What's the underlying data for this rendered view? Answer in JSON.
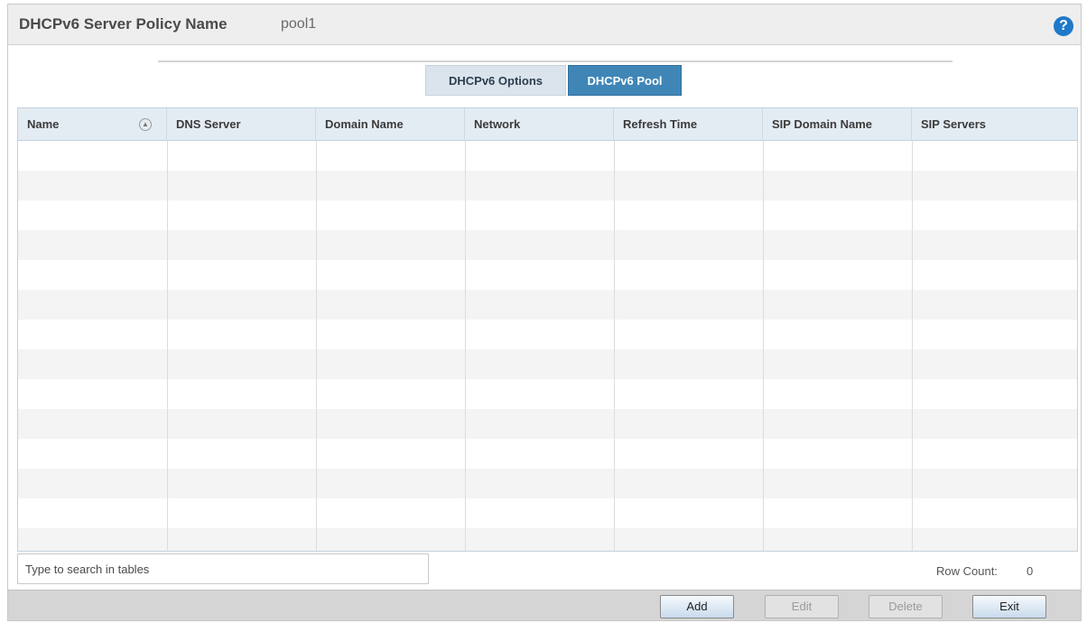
{
  "header": {
    "title_label": "DHCPv6 Server Policy Name",
    "title_value": "pool1",
    "help_symbol": "?"
  },
  "tabs": [
    {
      "label": "DHCPv6 Options",
      "active": false
    },
    {
      "label": "DHCPv6 Pool",
      "active": true
    }
  ],
  "table": {
    "columns": [
      "Name",
      "DNS Server",
      "Domain Name",
      "Network",
      "Refresh Time",
      "SIP Domain Name",
      "SIP Servers"
    ],
    "sort_icon": "sort-ascending-icon",
    "rows": []
  },
  "search": {
    "placeholder": "Type to search in tables"
  },
  "row_count": {
    "label": "Row Count:",
    "value": "0"
  },
  "buttons": {
    "add": "Add",
    "edit": "Edit",
    "delete": "Delete",
    "exit": "Exit"
  },
  "colors": {
    "active_tab": "#3f86b7",
    "help_icon": "#1f79c9",
    "table_header": "#e4ecf3"
  }
}
